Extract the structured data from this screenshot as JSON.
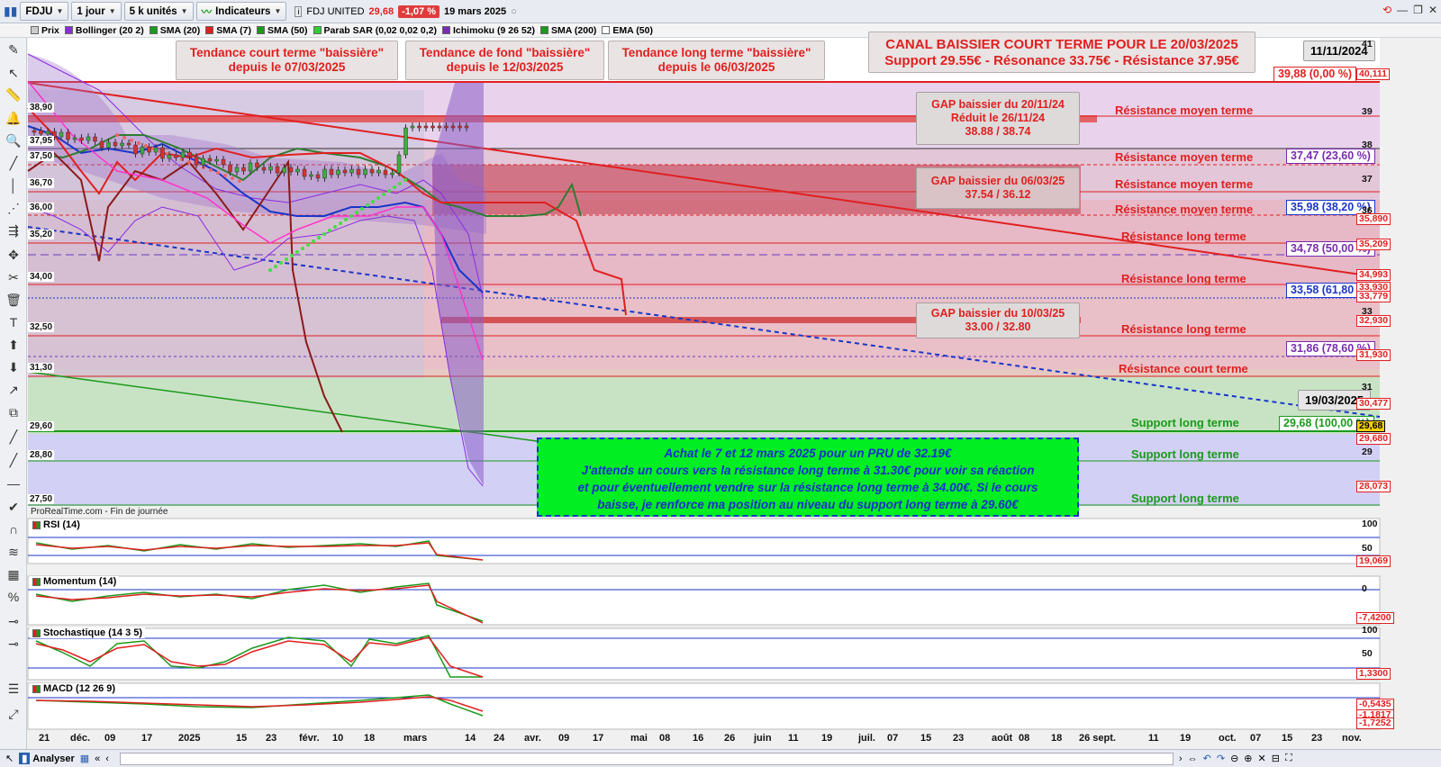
{
  "toolbar": {
    "symbol": "FDJU",
    "timeframe": "1 jour",
    "units": "5 k unités",
    "indicators_label": "Indicateurs",
    "instrument": "FDJ UNITED",
    "last_price": "29,68",
    "change": "-1,07 %",
    "date": "19 mars 2025"
  },
  "indicator_bar": [
    {
      "label": "Prix",
      "color": "#cccccc"
    },
    {
      "label": "Bollinger (20 2)",
      "color": "#8a2be2"
    },
    {
      "label": "SMA (20)",
      "color": "#1a9a1a"
    },
    {
      "label": "SMA (7)",
      "color": "#e02020"
    },
    {
      "label": "SMA (50)",
      "color": "#1a9a1a"
    },
    {
      "label": "Parab SAR (0,02 0,02 0,2)",
      "color": "#33cc33"
    },
    {
      "label": "Ichimoku (9 26 52)",
      "color": "#7a2ab0"
    },
    {
      "label": "SMA (200)",
      "color": "#1a9a1a"
    },
    {
      "label": "EMA (50)",
      "color": "#ffffff"
    }
  ],
  "annotations": {
    "trend_short": [
      "Tendance court terme \"baissière\"",
      "depuis le 07/03/2025"
    ],
    "trend_base": [
      "Tendance de fond \"baissière\"",
      "depuis le 12/03/2025"
    ],
    "trend_long": [
      "Tendance long terme \"baissière\"",
      "depuis le 06/03/2025"
    ],
    "canal": [
      "CANAL BAISSIER COURT TERME POUR LE 20/03/2025",
      "Support 29.55€ - Résonance 33.75€ - Résistance 37.95€"
    ],
    "gap1": [
      "GAP baissier du 20/11/24",
      "Réduit le 26/11/24",
      "38.88 / 38.74"
    ],
    "gap2": [
      "GAP baissier du 06/03/25",
      "37.54 / 36.12"
    ],
    "gap3": [
      "GAP baissier du 10/03/25",
      "33.00 / 32.80"
    ],
    "date_top": "11/11/2024",
    "date_bottom": "19/03/2025",
    "source": "ProRealTime.com - Fin de journée",
    "note": [
      "Achat le 7 et 12 mars 2025 pour un PRU de 32.19€",
      "J'attends un cours vers la résistance long terme à 31.30€ pour voir sa réaction",
      "et pour éventuellement vendre sur la résistance long terme à 34.00€. Si le cours",
      "baisse, je renforce ma position au niveau du support long terme à 29.60€"
    ]
  },
  "levels": [
    {
      "label": "Résistance moyen terme",
      "kind": "res"
    },
    {
      "label": "Résistance moyen terme",
      "kind": "res"
    },
    {
      "label": "Résistance moyen terme",
      "kind": "res"
    },
    {
      "label": "Résistance moyen terme",
      "kind": "res"
    },
    {
      "label": "Résistance long terme",
      "kind": "res"
    },
    {
      "label": "Résistance long terme",
      "kind": "res"
    },
    {
      "label": "Résistance long terme",
      "kind": "res"
    },
    {
      "label": "Résistance court terme",
      "kind": "res"
    },
    {
      "label": "Support long terme",
      "kind": "sup"
    },
    {
      "label": "Support long terme",
      "kind": "sup"
    },
    {
      "label": "Support long terme",
      "kind": "sup"
    }
  ],
  "fibo": [
    {
      "label": "39,88 (0,00 %)",
      "color": "#e02020"
    },
    {
      "label": "37,47 (23,60 %)",
      "color": "#7a2ab0"
    },
    {
      "label": "35,98 (38,20 %)",
      "color": "#1a35c8"
    },
    {
      "label": "34,78 (50,00 %)",
      "color": "#7a2ab0"
    },
    {
      "label": "33,58 (61,80 %)",
      "color": "#1a35c8"
    },
    {
      "label": "31,86 (78,60 %)",
      "color": "#7a2ab0"
    },
    {
      "label": "29,68 (100,00 %)",
      "color": "#1a9a1a"
    }
  ],
  "left_price_tags": [
    "38,90",
    "37,95",
    "37,50",
    "36,70",
    "36,00",
    "35,20",
    "34,00",
    "32,50",
    "31,30",
    "29,60",
    "28,80",
    "27,50"
  ],
  "right_axis": {
    "ticks": [
      "41",
      "39",
      "38",
      "37",
      "36",
      "35",
      "33",
      "31",
      "30",
      "29"
    ],
    "boxes": [
      "40,111",
      "35,890",
      "35,209",
      "34,993",
      "33,930",
      "33,779",
      "32,930",
      "31,930",
      "30,477",
      "29,68",
      "29,680",
      "28,073"
    ]
  },
  "panels": [
    {
      "title": "RSI (14)",
      "scale": [
        "100",
        "50",
        "19,069"
      ]
    },
    {
      "title": "Momentum (14)",
      "scale": [
        "0",
        "-7,4200"
      ]
    },
    {
      "title": "Stochastique (14 3 5)",
      "scale": [
        "100",
        "50",
        "1,3300"
      ]
    },
    {
      "title": "MACD (12 26 9)",
      "scale": [
        "-0,5435",
        "-1,1817",
        "-1,7252"
      ]
    }
  ],
  "x_labels": [
    "21",
    "déc.",
    "09",
    "17",
    "2025",
    "15",
    "23",
    "févr.",
    "10",
    "18",
    "mars",
    "14",
    "24",
    "avr.",
    "09",
    "17",
    "mai",
    "08",
    "16",
    "26",
    "juin",
    "11",
    "19",
    "juil.",
    "07",
    "15",
    "23",
    "août",
    "08",
    "18",
    "26 sept.",
    "11",
    "19",
    "oct.",
    "07",
    "15",
    "23",
    "nov."
  ],
  "bottom": {
    "analyser": "Analyser"
  },
  "colors": {
    "red": "#e02020",
    "green": "#1a9a1a",
    "blue": "#1a35c8",
    "purple": "#7a2ab0"
  }
}
